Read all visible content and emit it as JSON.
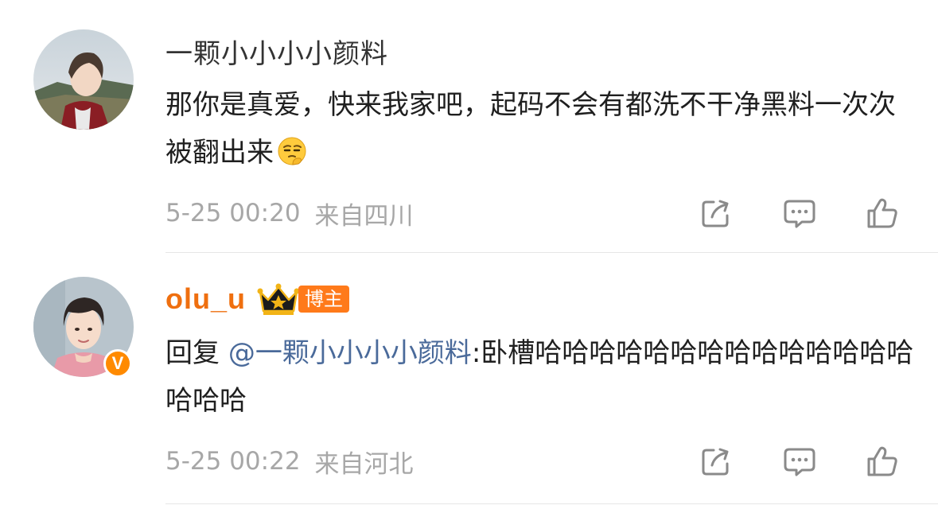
{
  "comments": [
    {
      "username": "一颗小小小小颜料",
      "content": "那你是真爱，快来我家吧，起码不会有都洗不干净黑料一次次被翻出来",
      "emoji": "thinking-face-emoji",
      "time": "5-25 00:20",
      "location": "来自四川",
      "actions": [
        "share-icon",
        "comment-icon",
        "like-icon"
      ]
    },
    {
      "username": "olu_u",
      "role_badge": "博主",
      "verified_badge": "V",
      "reply_prefix": "回复 ",
      "mention": "@一颗小小小小颜料",
      "content": ":卧槽哈哈哈哈哈哈哈哈哈哈哈哈哈哈哈哈哈",
      "time": "5-25 00:22",
      "location": "来自河北",
      "actions": [
        "share-icon",
        "comment-icon",
        "like-icon"
      ]
    }
  ],
  "colors": {
    "vip_name": "#ef6f0f",
    "mention": "#4a6a9a",
    "meta_text": "#a7a7a7",
    "badge_bg": "#ff7a1a",
    "verified_bg": "#ff8a00"
  }
}
